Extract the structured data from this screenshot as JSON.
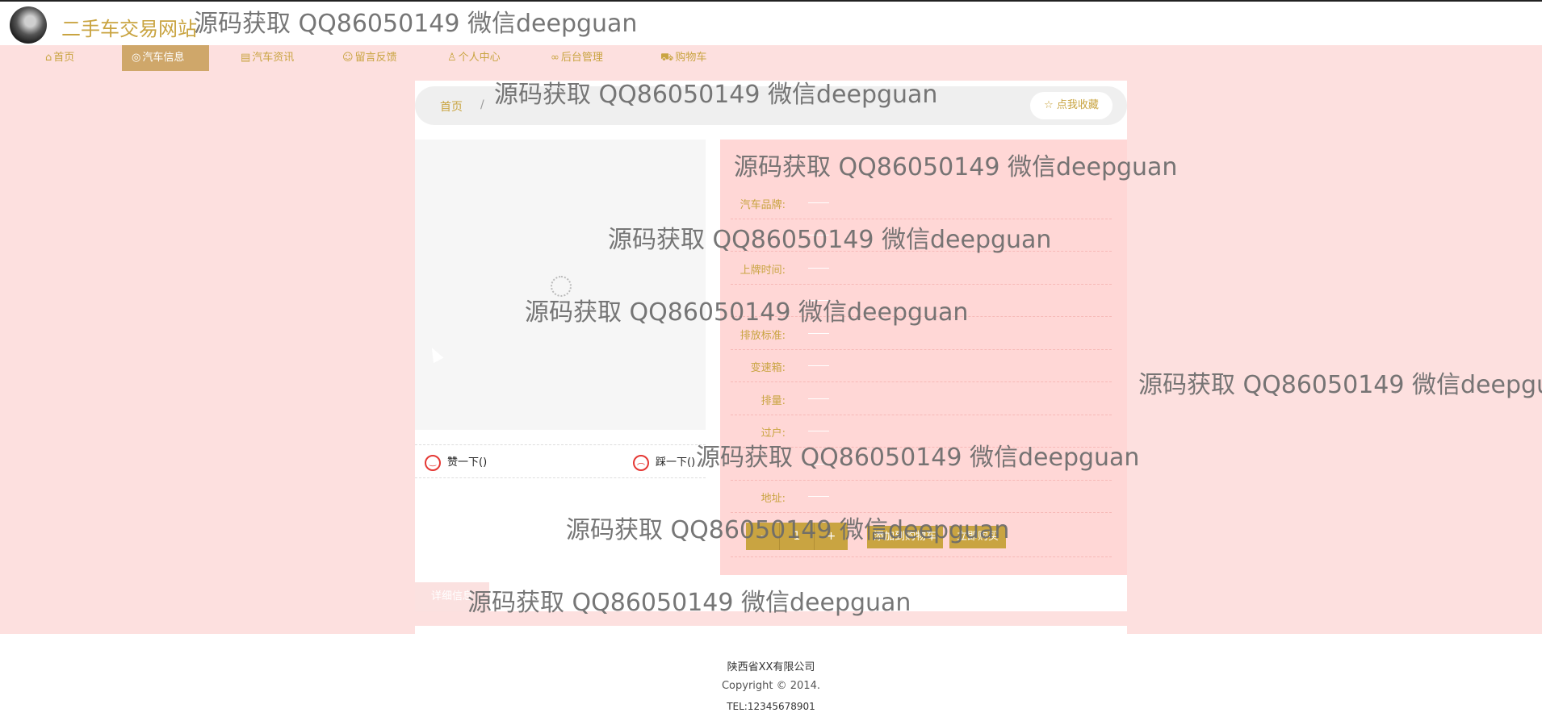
{
  "site": {
    "title": "二手车交易网站"
  },
  "watermark": "源码获取 QQ86050149 微信deepguan",
  "nav": {
    "items": [
      {
        "icon": "home-icon",
        "glyph": "⌂",
        "label": "首页"
      },
      {
        "icon": "car-icon",
        "glyph": "◎",
        "label": "汽车信息"
      },
      {
        "icon": "news-icon",
        "glyph": "▤",
        "label": "汽车资讯"
      },
      {
        "icon": "message-icon",
        "glyph": "☺",
        "label": "留言反馈"
      },
      {
        "icon": "user-icon",
        "glyph": "♙",
        "label": "个人中心"
      },
      {
        "icon": "link-icon",
        "glyph": "∞",
        "label": "后台管理"
      },
      {
        "icon": "cart-icon",
        "glyph": "⛟",
        "label": "购物车"
      }
    ],
    "active_index": 1
  },
  "breadcrumb": {
    "home": "首页",
    "separator": "/"
  },
  "favorite": {
    "icon": "star-icon",
    "label": "点我收藏"
  },
  "votes": {
    "like": "赞一下()",
    "dislike": "踩一下()"
  },
  "info": {
    "rows": [
      {
        "label": "汽车品牌:"
      },
      {
        "label": ""
      },
      {
        "label": "上牌时间:"
      },
      {
        "label": ""
      },
      {
        "label": "排放标准:"
      },
      {
        "label": "变速箱:"
      },
      {
        "label": "排量:"
      },
      {
        "label": "过户:"
      },
      {
        "label": ""
      },
      {
        "label": "地址:"
      }
    ]
  },
  "quantity": {
    "minus": "-",
    "value": "1",
    "plus": "+"
  },
  "actions": {
    "add_cart": "添加到购物车",
    "buy_now": "立即购买"
  },
  "detail": {
    "tab": "详细信息"
  },
  "footer": {
    "company": "陕西省XX有限公司",
    "copyright": "Copyright © 2014.",
    "tel": "TEL:12345678901"
  },
  "colors": {
    "accent": "#c9a441",
    "pink": "#fde0df",
    "panel": "#ffd7d6",
    "active_nav": "#cfa76a"
  }
}
